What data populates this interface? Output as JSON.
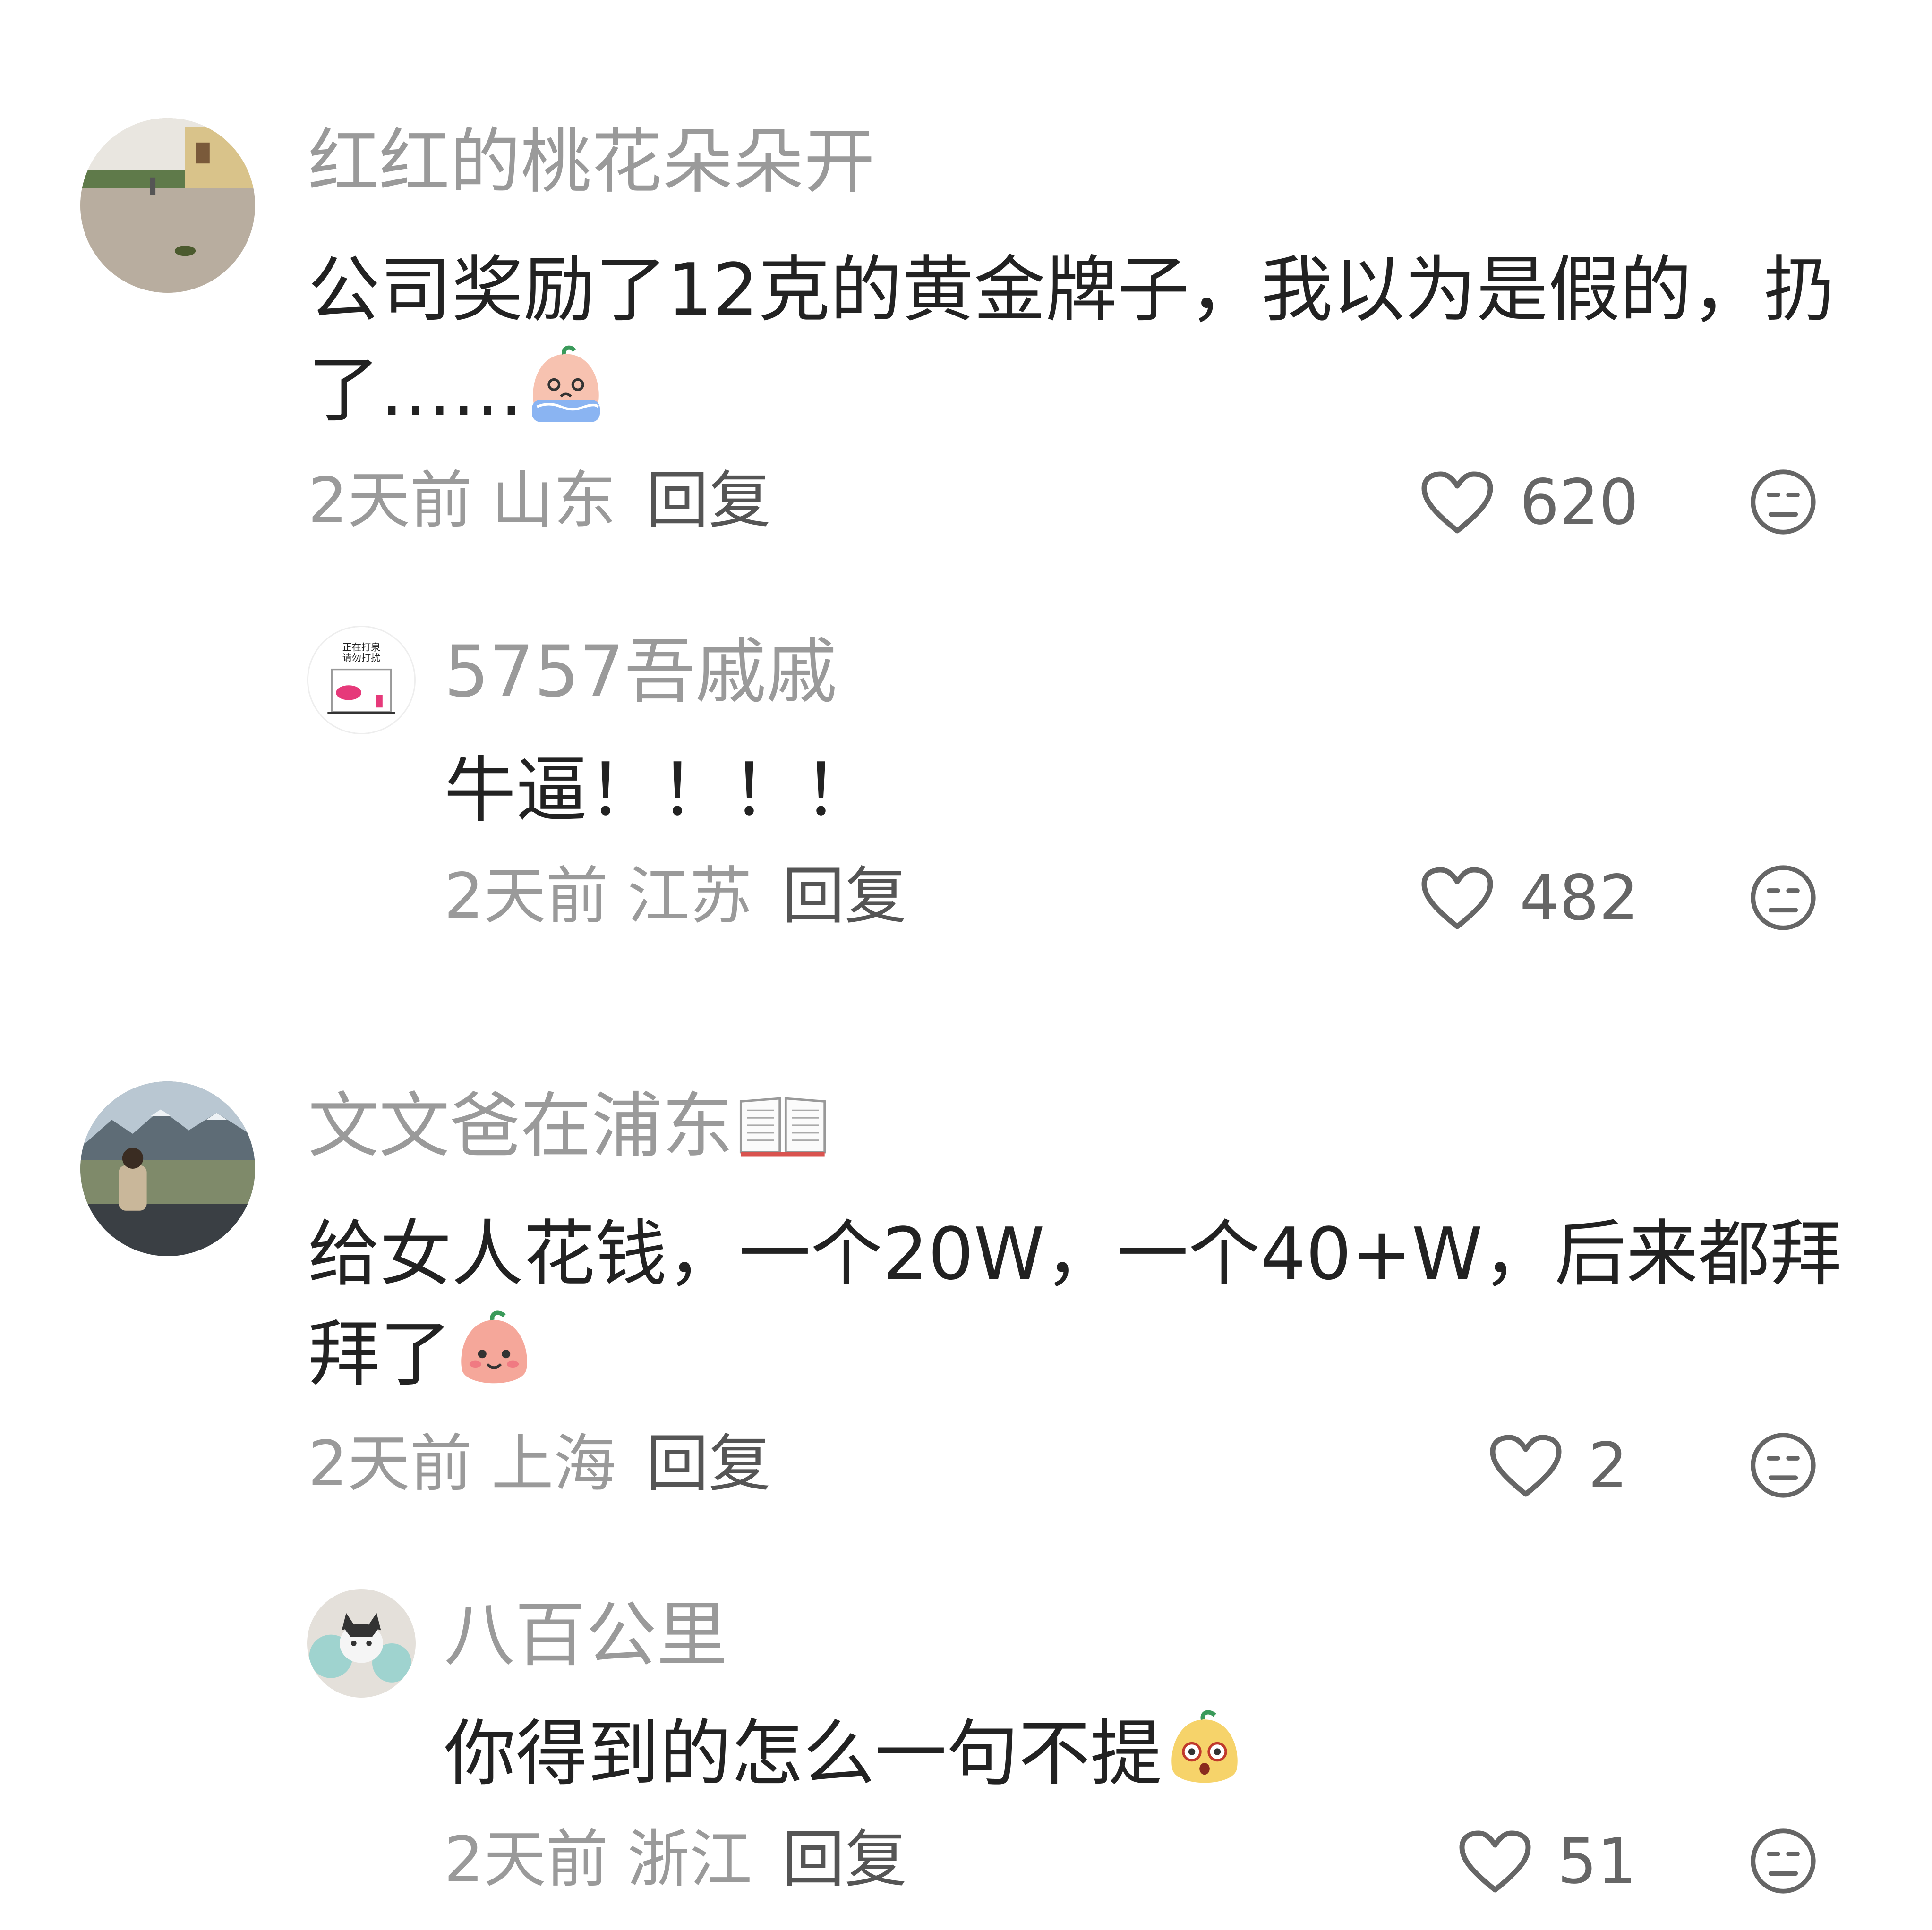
{
  "colors": {
    "author": "#9a9a9a",
    "body": "#222222",
    "meta": "#9a9a9a",
    "reply": "#555555",
    "icon": "#666666"
  },
  "comments": [
    {
      "author": "红红的桃花朵朵开",
      "text": "公司奖励了12克的黄金牌子，我以为是假的，扔了……",
      "emoji": "crying-peach-emoji",
      "time": "2天前",
      "location": "山东",
      "reply_label": "回复",
      "likes": "620",
      "avatar_icon": "street-photo-avatar"
    },
    {
      "author": "5757吾戚戚",
      "text": "牛逼！！！！",
      "time": "2天前",
      "location": "江苏",
      "reply_label": "回复",
      "likes": "482",
      "avatar_icon": "do-not-disturb-sign-avatar"
    },
    {
      "author": "文文爸在浦东",
      "author_badge": "open-book-icon",
      "text": "给女人花钱，一个20W，一个40+W，后来都拜拜了",
      "emoji": "smiling-peach-emoji",
      "time": "2天前",
      "location": "上海",
      "reply_label": "回复",
      "likes": "2",
      "avatar_icon": "mountain-landscape-avatar"
    },
    {
      "author": "八百公里",
      "text": "你得到的怎么一句不提",
      "emoji": "shocked-peach-emoji",
      "time": "2天前",
      "location": "浙江",
      "reply_label": "回复",
      "likes": "51",
      "avatar_icon": "cat-avatar"
    }
  ]
}
